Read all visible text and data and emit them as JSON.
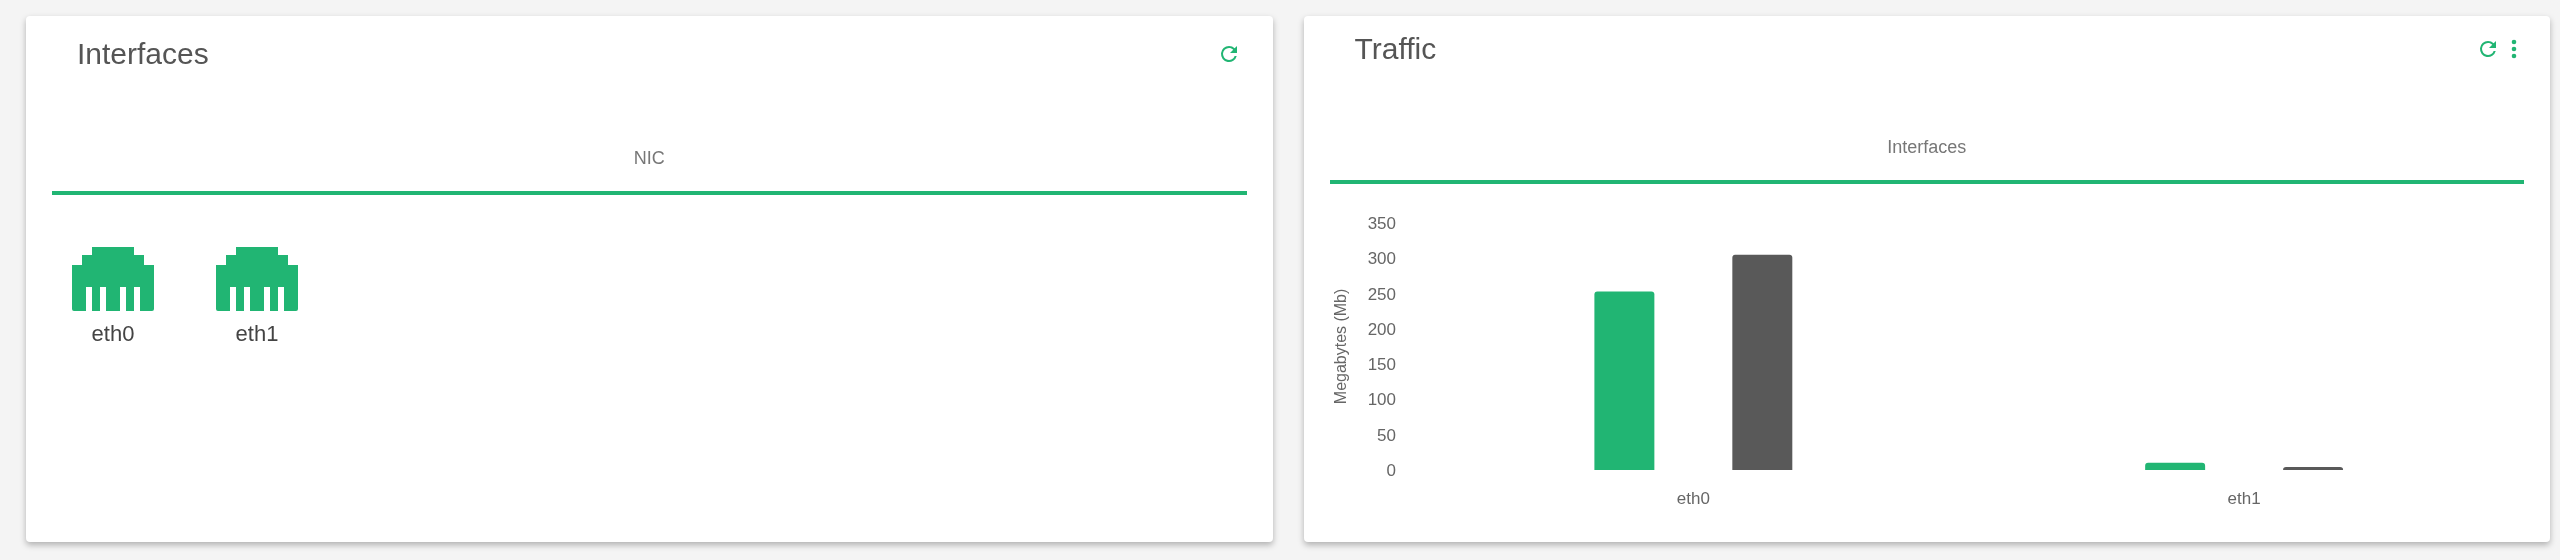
{
  "cards": [
    {
      "title": "Interfaces",
      "actions": [
        {
          "kind": "refresh"
        }
      ],
      "tabs": [
        {
          "label": "NIC",
          "selected": true
        }
      ],
      "kind": "nics",
      "interfaces": [
        {
          "name": "eth0"
        },
        {
          "name": "eth1"
        }
      ]
    },
    {
      "title": "Traffic",
      "actions": [
        {
          "kind": "refresh"
        },
        {
          "kind": "menu"
        }
      ],
      "tabs": [
        {
          "label": "Interfaces",
          "selected": true
        }
      ],
      "kind": "chart",
      "chart_data": {
        "type": "bar",
        "ylabel": "Megabytes (Mb)",
        "categories": [
          "eth0",
          "eth1"
        ],
        "ylim": [
          0,
          350
        ],
        "yticks": [
          0,
          50,
          100,
          150,
          200,
          250,
          300,
          350
        ],
        "series": [
          {
            "color": "#21b573",
            "values": [
              253,
              10
            ]
          },
          {
            "color": "#595959",
            "values": [
              305,
              4
            ]
          }
        ]
      }
    }
  ]
}
